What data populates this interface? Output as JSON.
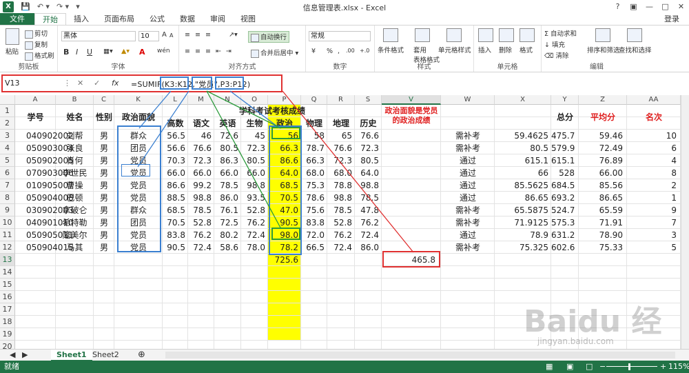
{
  "app": {
    "title": "信息管理表.xlsx - Excel",
    "login": "登录"
  },
  "tabs": [
    "文件",
    "开始",
    "插入",
    "页面布局",
    "公式",
    "数据",
    "审阅",
    "视图"
  ],
  "ribbon": {
    "clipboard": {
      "paste": "粘贴",
      "cut": "剪切",
      "copy": "复制",
      "format_painter": "格式刷",
      "label": "剪贴板"
    },
    "font": {
      "name": "黑体",
      "size": "10",
      "bold": "B",
      "italic": "I",
      "underline": "U",
      "font_color": "A",
      "wen": "wén",
      "grow": "A",
      "shrink": "A",
      "label": "字体"
    },
    "alignment": {
      "wrap": "自动换行",
      "merge": "合并后居中",
      "label": "对齐方式"
    },
    "number": {
      "format": "常规",
      "currency": "¥",
      "percent": "%",
      "comma": ",",
      "inc": ".00",
      "dec": "+.0",
      "label": "数字"
    },
    "styles": {
      "conditional": "条件格式",
      "table": "套用\n表格格式",
      "cell_styles": "单元格样式",
      "label": "样式"
    },
    "cells": {
      "insert": "插入",
      "delete": "删除",
      "format": "格式",
      "label": "单元格"
    },
    "editing": {
      "autosum": "自动求和",
      "fill": "填充",
      "clear": "清除",
      "sort": "排序和筛选",
      "find": "查找和选择",
      "label": "编辑"
    }
  },
  "formula_bar": {
    "name_box": "V13",
    "fx": "fx",
    "formula": "=SUMIF(K3:K12,\"党员\",P3:P12)"
  },
  "columns": [
    "A",
    "B",
    "C",
    "K",
    "L",
    "M",
    "N",
    "O",
    "P",
    "Q",
    "R",
    "S",
    "V",
    "W",
    "X",
    "Y",
    "Z",
    "AA"
  ],
  "rows": [
    "1",
    "2",
    "3",
    "4",
    "5",
    "6",
    "7",
    "8",
    "9",
    "10",
    "11",
    "12",
    "13",
    "14",
    "15",
    "16",
    "17",
    "18",
    "19",
    "20"
  ],
  "header": {
    "xuehao": "学号",
    "xingming": "姓名",
    "xingbie": "性别",
    "zhengzhi": "政治面貌",
    "group_title": "学科考试考核成绩",
    "subjects": [
      "高数",
      "语文",
      "英语",
      "生物",
      "政治",
      "物理",
      "地理",
      "历史"
    ],
    "v_note": "政治面貌是党员的政治成绩",
    "total": "总分",
    "avg": "平均分",
    "rank": "名次"
  },
  "table": [
    [
      "040902002",
      "刘帮",
      "男",
      "群众",
      "56.5",
      "46",
      "72.6",
      "45",
      "56",
      "58",
      "65",
      "76.6",
      "需补考",
      "59.4625",
      "475.7",
      "59.46",
      "10"
    ],
    [
      "050903004",
      "张良",
      "男",
      "团员",
      "56.6",
      "76.6",
      "80.5",
      "72.3",
      "66.3",
      "78.7",
      "76.6",
      "72.3",
      "需补考",
      "80.5",
      "579.9",
      "72.49",
      "6"
    ],
    [
      "050902005",
      "肖何",
      "男",
      "党员",
      "70.3",
      "72.3",
      "86.3",
      "80.5",
      "86.6",
      "66.3",
      "72.3",
      "80.5",
      "通过",
      "615.1",
      "615.1",
      "76.89",
      "4"
    ],
    [
      "070903006",
      "李世民",
      "男",
      "党员",
      "66.0",
      "66.0",
      "66.0",
      "66.0",
      "64.0",
      "68.0",
      "68.0",
      "64.0",
      "通过",
      "66",
      "528",
      "66.00",
      "8"
    ],
    [
      "010905007",
      "曹操",
      "男",
      "党员",
      "86.6",
      "99.2",
      "78.5",
      "98.8",
      "68.5",
      "75.3",
      "78.8",
      "98.8",
      "通过",
      "85.5625",
      "684.5",
      "85.56",
      "2"
    ],
    [
      "050904008",
      "巴顿",
      "男",
      "党员",
      "88.5",
      "98.8",
      "86.0",
      "93.5",
      "70.5",
      "78.6",
      "98.8",
      "78.5",
      "通过",
      "86.65",
      "693.2",
      "86.65",
      "1"
    ],
    [
      "030902003",
      "拿破仑",
      "男",
      "群众",
      "68.5",
      "78.5",
      "76.1",
      "52.8",
      "47.0",
      "75.6",
      "78.5",
      "47.8",
      "需补考",
      "65.5875",
      "524.7",
      "65.59",
      "9"
    ],
    [
      "040901010",
      "希特勒",
      "男",
      "团员",
      "70.5",
      "52.8",
      "72.5",
      "76.2",
      "90.5",
      "83.8",
      "52.8",
      "76.2",
      "需补考",
      "71.9125",
      "575.3",
      "71.91",
      "7"
    ],
    [
      "050905011",
      "隆美尔",
      "男",
      "党员",
      "83.8",
      "76.2",
      "80.2",
      "72.4",
      "98.0",
      "72.0",
      "76.2",
      "72.4",
      "通过",
      "78.9",
      "631.2",
      "78.90",
      "3"
    ],
    [
      "050904015",
      "马其",
      "男",
      "党员",
      "90.5",
      "72.4",
      "58.6",
      "78.0",
      "78.2",
      "66.5",
      "72.4",
      "86.0",
      "需补考",
      "75.325",
      "602.6",
      "75.33",
      "5"
    ]
  ],
  "p13": "725.6",
  "v13": "465.8",
  "sheets": [
    "Sheet1",
    "Sheet2"
  ],
  "status": {
    "ready": "就绪",
    "zoom": "115%"
  },
  "watermark": {
    "main": "Baidu 经验",
    "sub": "jingyan.baidu.com"
  },
  "colors": {
    "excel_green": "#217346",
    "highlight": "#ffff00",
    "red_frame": "#e03030",
    "blue_frame": "#3a7fd0",
    "green_frame": "#2a9a3a"
  }
}
